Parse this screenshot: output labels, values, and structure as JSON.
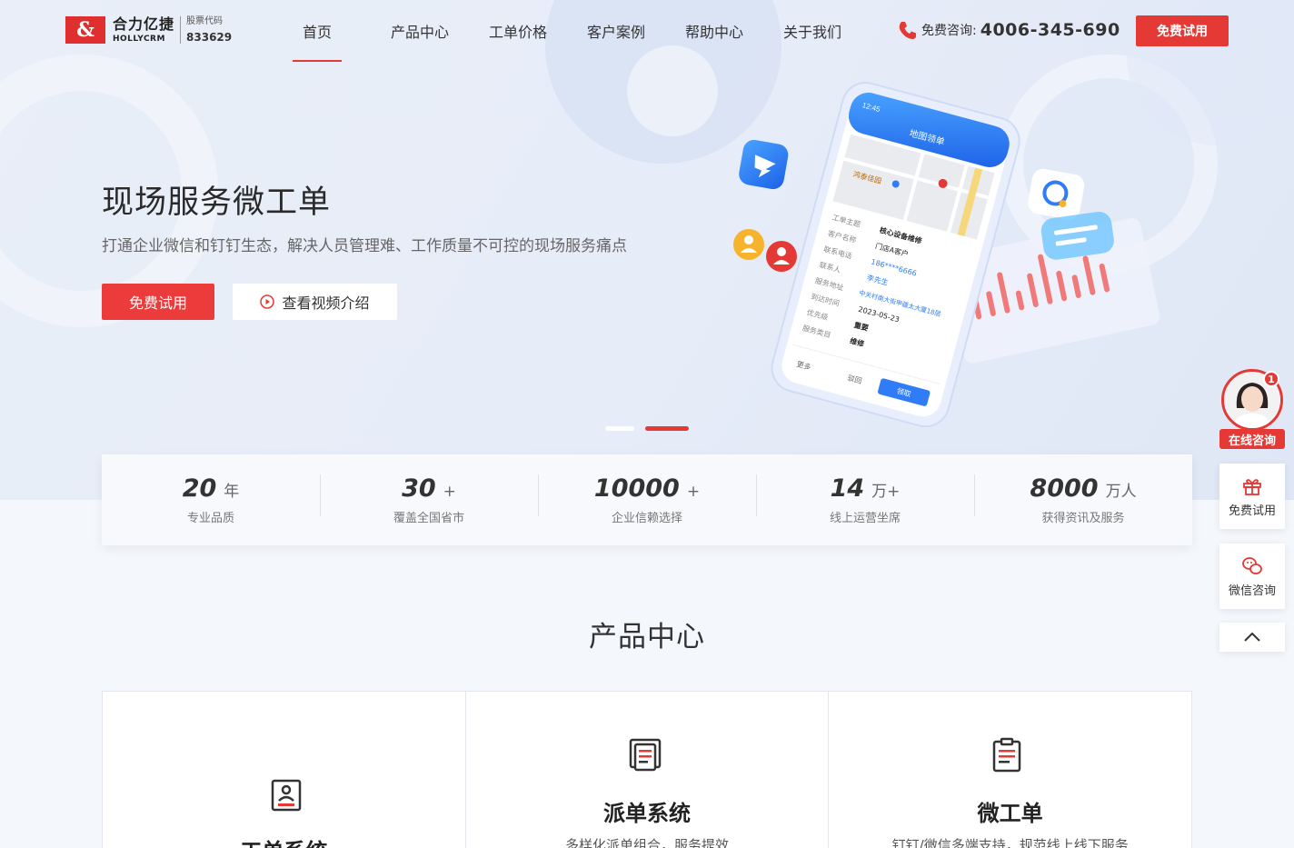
{
  "logo": {
    "mark": "&",
    "name_cn": "合力亿捷",
    "name_en": "HOLLYCRM",
    "stock_label": "股票代码",
    "stock_code": "833629"
  },
  "nav": {
    "items": [
      "首页",
      "产品中心",
      "工单价格",
      "客户案例",
      "帮助中心",
      "关于我们"
    ],
    "active_index": 0
  },
  "header": {
    "phone_label": "免费咨询:",
    "phone_number": "4006-345-690",
    "trial_button": "免费试用"
  },
  "hero": {
    "title": "现场服务微工单",
    "subtitle": "打通企业微信和钉钉生态，解决人员管理难、工作质量不可控的现场服务痛点",
    "primary_button": "免费试用",
    "video_button": "查看视频介绍"
  },
  "phone_mock": {
    "status_time": "12:45",
    "app_title": "地图领单",
    "map_label_1": "鸿泰佳园",
    "fields": [
      {
        "label": "工单主题",
        "value": "核心设备维修"
      },
      {
        "label": "客户名称",
        "value": "门店A客户"
      },
      {
        "label": "联系电话",
        "value": "186****6666"
      },
      {
        "label": "联系人",
        "value": "李先生"
      },
      {
        "label": "服务地址",
        "value": "中关村南大街甲疆太大厦18层"
      },
      {
        "label": "到达时间",
        "value": "2023-05-23"
      },
      {
        "label": "优先级",
        "value": "重要"
      },
      {
        "label": "服务类目",
        "value": "维修"
      }
    ],
    "footer_more": "更多",
    "footer_back": "驳回",
    "footer_claim": "领取"
  },
  "stats": [
    {
      "value": "20",
      "unit": "年",
      "label": "专业品质"
    },
    {
      "value": "30",
      "unit": "+",
      "label": "覆盖全国省市"
    },
    {
      "value": "10000",
      "unit": "+",
      "label": "企业信赖选择"
    },
    {
      "value": "14",
      "unit": "万+",
      "label": "线上运营坐席"
    },
    {
      "value": "8000",
      "unit": "万人",
      "label": "获得资讯及服务"
    }
  ],
  "products": {
    "title": "产品中心",
    "cards": [
      {
        "title": "工单系统",
        "desc": ""
      },
      {
        "title": "派单系统",
        "desc": "多样化派单组合，服务提效"
      },
      {
        "title": "微工单",
        "desc": "钉钉/微信多端支持，规范线上线下服务"
      }
    ]
  },
  "side": {
    "badge": "1",
    "consult_label": "在线咨询",
    "trial_label": "免费试用",
    "wechat_label": "微信咨询"
  },
  "colors": {
    "brand_red": "#e53935",
    "phone_blue": "#2f7cf6"
  }
}
